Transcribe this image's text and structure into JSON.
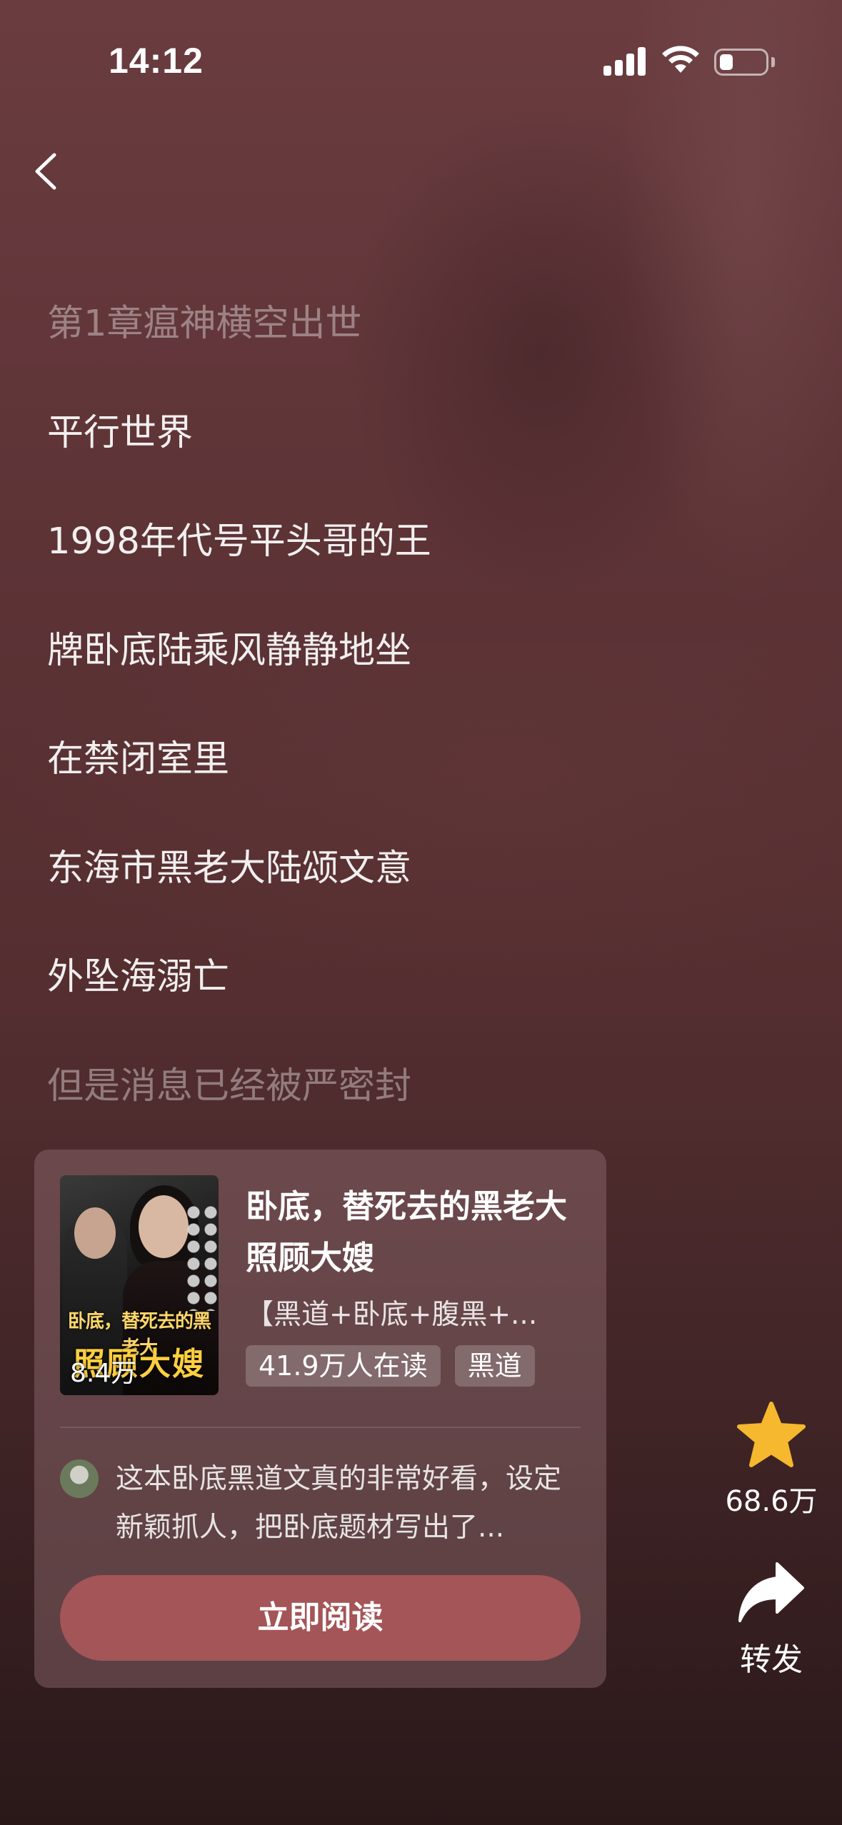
{
  "status_bar": {
    "time": "14:12"
  },
  "chapter": {
    "lines": [
      "第1章瘟神横空出世",
      "平行世界",
      "1998年代号平头哥的王",
      "牌卧底陆乘风静静地坐",
      "在禁闭室里",
      "东海市黑老大陆颂文意",
      "外坠海溺亡",
      "但是消息已经被严密封"
    ]
  },
  "book": {
    "title": "卧底，替死去的黑老大照顾大嫂",
    "tags_text": "【黑道+卧底+腹黑+...",
    "readers": "41.9万人在读",
    "genre": "黑道",
    "cover": {
      "title_small": "卧底，替死去的黑老大",
      "title_big": "照顾大嫂",
      "count": "8.4万"
    },
    "review": "这本卧底黑道文真的非常好看，设定新颖抓人，把卧底题材写出了...",
    "read_button": "立即阅读"
  },
  "actions": {
    "favorite_count": "68.6万",
    "share_label": "转发"
  },
  "colors": {
    "accent_button": "#a45557",
    "star": "#f5b82e"
  }
}
